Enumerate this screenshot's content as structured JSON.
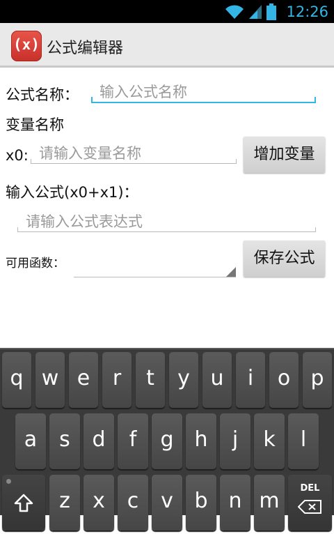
{
  "status_bar": {
    "time": "12:26"
  },
  "app": {
    "icon_text": "(x)",
    "title": "公式编辑器"
  },
  "form": {
    "name_label": "公式名称：",
    "name_placeholder": "输入公式名称",
    "var_section_label": "变量名称",
    "var_prefix": "x0:",
    "var_placeholder": "请输入变量名称",
    "add_var_button": "增加变量",
    "formula_label": "输入公式(x0+x1)：",
    "formula_placeholder": "请输入公式表达式",
    "functions_label": "可用函数：",
    "save_button": "保存公式"
  },
  "keyboard": {
    "row1": [
      "q",
      "w",
      "e",
      "r",
      "t",
      "y",
      "u",
      "i",
      "o",
      "p"
    ],
    "row2": [
      "a",
      "s",
      "d",
      "f",
      "g",
      "h",
      "j",
      "k",
      "l"
    ],
    "row3": [
      "z",
      "x",
      "c",
      "v",
      "b",
      "n",
      "m"
    ],
    "del_label": "DEL",
    "shift_icon": "shift-icon",
    "delete_icon": "backspace-icon"
  },
  "colors": {
    "accent": "#33b5e5",
    "app_icon": "#d63b31"
  }
}
